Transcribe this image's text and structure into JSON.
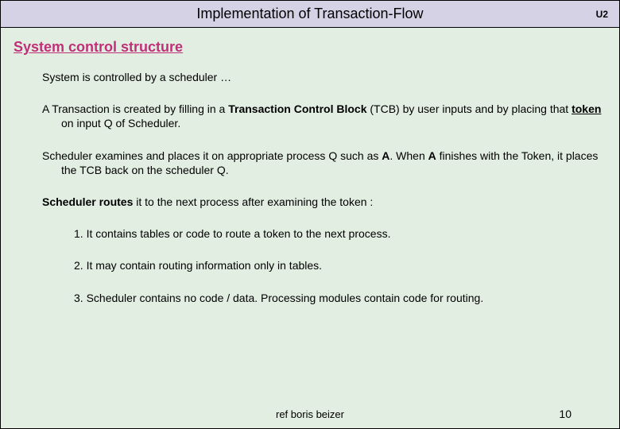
{
  "header": {
    "title": "Implementation of Transaction-Flow",
    "unit": "U2"
  },
  "section_heading": "System control structure",
  "p1": "System is controlled by a scheduler …",
  "p2": {
    "pre": "A Transaction is created by filling in a ",
    "tcb_bold": "Transaction Control Block",
    "tcb_tail": " (TCB) by user inputs and by placing that ",
    "token": "token",
    "post": " on input Q of Scheduler."
  },
  "p3": {
    "pre": "Scheduler examines and places it on appropriate process Q such as ",
    "a1": "A",
    "mid": ".  When ",
    "a2": "A",
    "post": " finishes with the Token, it places the TCB back on the scheduler Q."
  },
  "p4": {
    "bold": "Scheduler routes",
    "rest": " it to the next process after examining the token :"
  },
  "list": {
    "i1": "1.  It contains tables or code to route a token to the next process.",
    "i2": "2.  It may contain routing information only in tables.",
    "i3": "3.  Scheduler contains no code / data.  Processing modules contain code for routing."
  },
  "footer": {
    "ref": "ref boris beizer",
    "page": "10"
  }
}
